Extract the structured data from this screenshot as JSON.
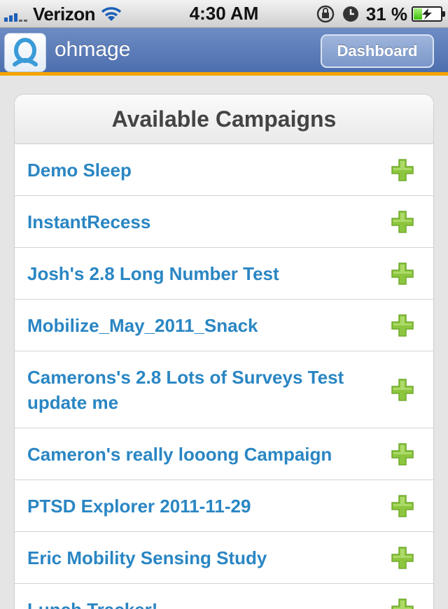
{
  "status_bar": {
    "carrier": "Verizon",
    "time": "4:30 AM",
    "battery_percent": "31 %",
    "battery_level": 0.31,
    "icons": [
      "signal-icon",
      "wifi-icon",
      "rotation-lock-icon",
      "alarm-icon",
      "battery-charging-icon"
    ]
  },
  "header": {
    "app_title": "ohmage",
    "dashboard_label": "Dashboard",
    "logo_icon": "ohmage-logo-icon"
  },
  "campaigns": {
    "title": "Available Campaigns",
    "action_icon": "add-plus-icon",
    "items": [
      {
        "name": "Demo Sleep"
      },
      {
        "name": "InstantRecess"
      },
      {
        "name": "Josh's 2.8 Long Number Test"
      },
      {
        "name": "Mobilize_May_2011_Snack"
      },
      {
        "name": "Camerons's 2.8 Lots of Surveys Test update me"
      },
      {
        "name": "Cameron's really looong Campaign"
      },
      {
        "name": "PTSD Explorer 2011-11-29"
      },
      {
        "name": "Eric Mobility Sensing Study"
      },
      {
        "name": "Lunch Tracker!"
      }
    ]
  },
  "colors": {
    "header_blue": "#5b7cb8",
    "header_accent": "#f5a300",
    "link_blue": "#2a86c3",
    "plus_green": "#8cc63f"
  }
}
